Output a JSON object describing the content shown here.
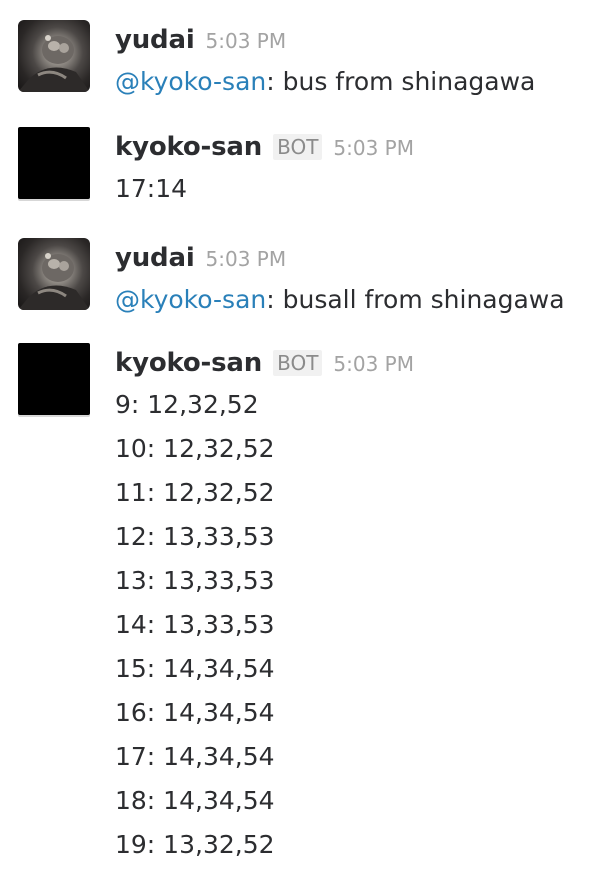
{
  "messages": [
    {
      "user": "yudai",
      "time": "5:03 PM",
      "mention": "@kyoko-san",
      "text": ": bus from shinagawa"
    },
    {
      "user": "kyoko-san",
      "badge": "BOT",
      "time": "5:03 PM",
      "text": "17:14"
    },
    {
      "user": "yudai",
      "time": "5:03 PM",
      "mention": "@kyoko-san",
      "text": ": busall from shinagawa"
    },
    {
      "user": "kyoko-san",
      "badge": "BOT",
      "time": "5:03 PM",
      "lines": [
        "9: 12,32,52",
        "10: 12,32,52",
        "11: 12,32,52",
        "12: 13,33,53",
        "13: 13,33,53",
        "14: 13,33,53",
        "15: 14,34,54",
        "16: 14,34,54",
        "17: 14,34,54",
        "18: 14,34,54",
        "19: 13,32,52"
      ]
    }
  ],
  "colors": {
    "text": "#2c2d30",
    "mention": "#2a80b9",
    "timestamp": "#a3a3a3",
    "badge_bg": "#f1f1f1",
    "badge_text": "#8b8b8b",
    "bot_avatar": "#000000"
  }
}
